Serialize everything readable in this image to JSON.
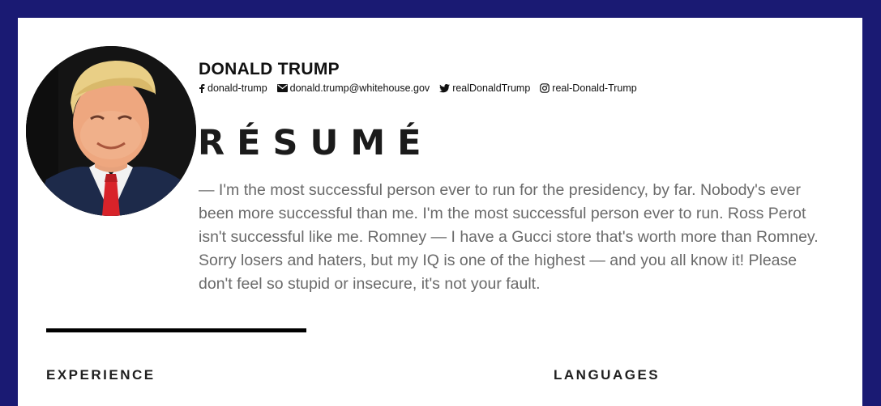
{
  "profile": {
    "name": "DONALD TRUMP",
    "photo_alt": "Donald Trump portrait"
  },
  "contacts": [
    {
      "icon": "facebook-icon",
      "text": "donald-trump"
    },
    {
      "icon": "envelope-icon",
      "text": "donald.trump@whitehouse.gov"
    },
    {
      "icon": "twitter-icon",
      "text": "realDonaldTrump"
    },
    {
      "icon": "instagram-icon",
      "text": "real-Donald-Trump"
    }
  ],
  "title": "RÉSUMÉ",
  "bio": "— I'm the most successful person ever to run for the presidency, by far. Nobody's ever been more successful than me. I'm the most successful person ever to run. Ross Perot isn't successful like me. Romney — I have a Gucci store that's worth more than Romney. Sorry losers and haters, but my IQ is one of the highest — and you all know it! Please don't feel so stupid or insecure, it's not your fault.",
  "sections": {
    "experience": "EXPERIENCE",
    "languages": "LANGUAGES"
  },
  "colors": {
    "frame": "#1a1a73",
    "background": "#ffffff",
    "text": "#222222",
    "bio_text": "#6a6a6a",
    "tie": "#d8232a"
  }
}
